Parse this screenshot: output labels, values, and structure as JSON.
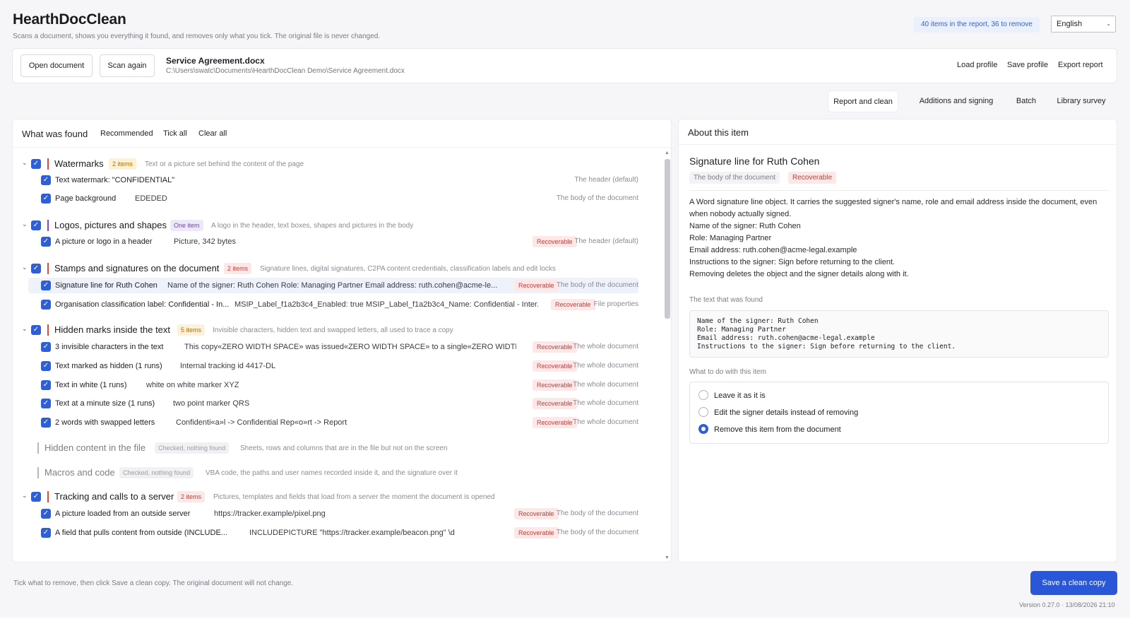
{
  "app": {
    "title": "HearthDocClean",
    "subtitle": "Scans a document, shows you everything it found, and removes only what you tick. The original file is never changed.",
    "summary": "40 items in the report, 36 to remove",
    "language": "English"
  },
  "toolbar": {
    "open_label": "Open document",
    "scan_label": "Scan again",
    "file_name": "Service Agreement.docx",
    "file_path": "C:\\Users\\swatc\\Documents\\HearthDocClean Demo\\Service Agreement.docx",
    "load_profile": "Load profile",
    "save_profile": "Save profile",
    "export_report": "Export report"
  },
  "tabs": [
    {
      "label": "Report and clean",
      "active": true
    },
    {
      "label": "Additions and signing",
      "active": false
    },
    {
      "label": "Batch",
      "active": false
    },
    {
      "label": "Library survey",
      "active": false
    }
  ],
  "found": {
    "title": "What was found",
    "recommended": "Recommended",
    "tick_all": "Tick all",
    "clear_all": "Clear all",
    "categories": [
      {
        "title": "Watermarks",
        "pill": "2 items",
        "desc": "Text or a picture set behind the content of the page",
        "items": [
          {
            "name": "Text watermark: \"CONFIDENTIAL\"",
            "detail": "",
            "rec": "",
            "loc": "The header (default)"
          },
          {
            "name": "Page background",
            "detail": "EDEDED",
            "rec": "",
            "loc": "The body of the document"
          }
        ]
      },
      {
        "title": "Logos, pictures and shapes",
        "pill": "One item",
        "desc": "A logo in the header, text boxes, shapes and pictures in the body",
        "items": [
          {
            "name": "A picture or logo in a header",
            "detail": "Picture, 342 bytes",
            "rec": "Recoverable",
            "loc": "The header (default)"
          }
        ]
      },
      {
        "title": "Stamps and signatures on the document",
        "pill": "2 items",
        "desc": "Signature lines, digital signatures, C2PA content credentials, classification labels and edit locks",
        "items": [
          {
            "name": "Signature line for Ruth Cohen",
            "detail": "Name of the signer: Ruth Cohen  Role: Managing Partner  Email address: ruth.cohen@acme-le...",
            "rec": "Recoverable",
            "loc": "The body of the document"
          },
          {
            "name": "Organisation classification label: Confidential - In...",
            "detail": "MSIP_Label_f1a2b3c4_Enabled: true  MSIP_Label_f1a2b3c4_Name: Confidential - Inter...",
            "rec": "Recoverable",
            "loc": "File properties"
          }
        ]
      },
      {
        "title": "Hidden marks inside the text",
        "pill": "5 items",
        "desc": "Invisible characters, hidden text and swapped letters, all used to trace a copy",
        "items": [
          {
            "name": "3 invisible characters in the text",
            "detail": "This copy«ZERO WIDTH SPACE» was issued«ZERO WIDTH SPACE» to a single«ZERO WIDTH SPACE...",
            "rec": "Recoverable",
            "loc": "The whole document"
          },
          {
            "name": "Text marked as hidden (1 runs)",
            "detail": "Internal tracking id 4417-DL",
            "rec": "Recoverable",
            "loc": "The whole document"
          },
          {
            "name": "Text in white (1 runs)",
            "detail": "white on white marker XYZ",
            "rec": "Recoverable",
            "loc": "The whole document"
          },
          {
            "name": "Text at a minute size (1 runs)",
            "detail": "two point marker QRS",
            "rec": "Recoverable",
            "loc": "The whole document"
          },
          {
            "name": "2 words with swapped letters",
            "detail": "Confidenti«a»l  ->  Confidential  Rep«o»rt  ->  Report",
            "rec": "Recoverable",
            "loc": "The whole document"
          }
        ]
      },
      {
        "title": "Hidden content in the file",
        "pill": "Checked, nothing found",
        "desc": "Sheets, rows and columns that are in the file but not on the screen"
      },
      {
        "title": "Macros and code",
        "pill": "Checked, nothing found",
        "desc": "VBA code, the paths and user names recorded inside it, and the signature over it"
      },
      {
        "title": "Tracking and calls to a server",
        "pill": "2 items",
        "desc": "Pictures, templates and fields that load from a server the moment the document is opened",
        "items": [
          {
            "name": "A picture loaded from an outside server",
            "detail": "https://tracker.example/pixel.png",
            "rec": "Recoverable",
            "loc": "The body of the document"
          },
          {
            "name": "A field that pulls content from outside (INCLUDE...",
            "detail": "INCLUDEPICTURE \"https://tracker.example/beacon.png\" \\d",
            "rec": "Recoverable",
            "loc": "The body of the document"
          }
        ]
      }
    ]
  },
  "about": {
    "header": "About this item",
    "title": "Signature line for Ruth Cohen",
    "location": "The body of the document",
    "recoverable": "Recoverable",
    "desc_line1": "A Word signature line object. It carries the suggested signer's name, role and email address inside the document, even",
    "desc_line2": "when nobody actually signed.",
    "name_line": "Name of the signer: Ruth Cohen",
    "role_line": "Role: Managing Partner",
    "email_line": "Email address: ruth.cohen@acme-legal.example",
    "instr_line": "Instructions to the signer: Sign before returning to the client.",
    "remove_line": "Removing deletes the object and the signer details along with it.",
    "text_found_label": "The text that was found",
    "code": [
      "Name of the signer: Ruth Cohen",
      "Role: Managing Partner",
      "Email address: ruth.cohen@acme-legal.example",
      "Instructions to the signer: Sign before returning to the client."
    ],
    "action_label": "What to do with this item",
    "options": [
      {
        "label": "Leave it as it is",
        "selected": false
      },
      {
        "label": "Edit the signer details instead of removing",
        "selected": false
      },
      {
        "label": "Remove this item from the document",
        "selected": true
      }
    ]
  },
  "footer": {
    "hint": "Tick what to remove, then click Save a clean copy. The original document will not change.",
    "save_label": "Save a clean copy",
    "version": "Version 0.27.0  ·  13/08/2026 21:10"
  },
  "colors": {
    "accent": "#2f5fd6",
    "recoverable": "#c5413b"
  }
}
